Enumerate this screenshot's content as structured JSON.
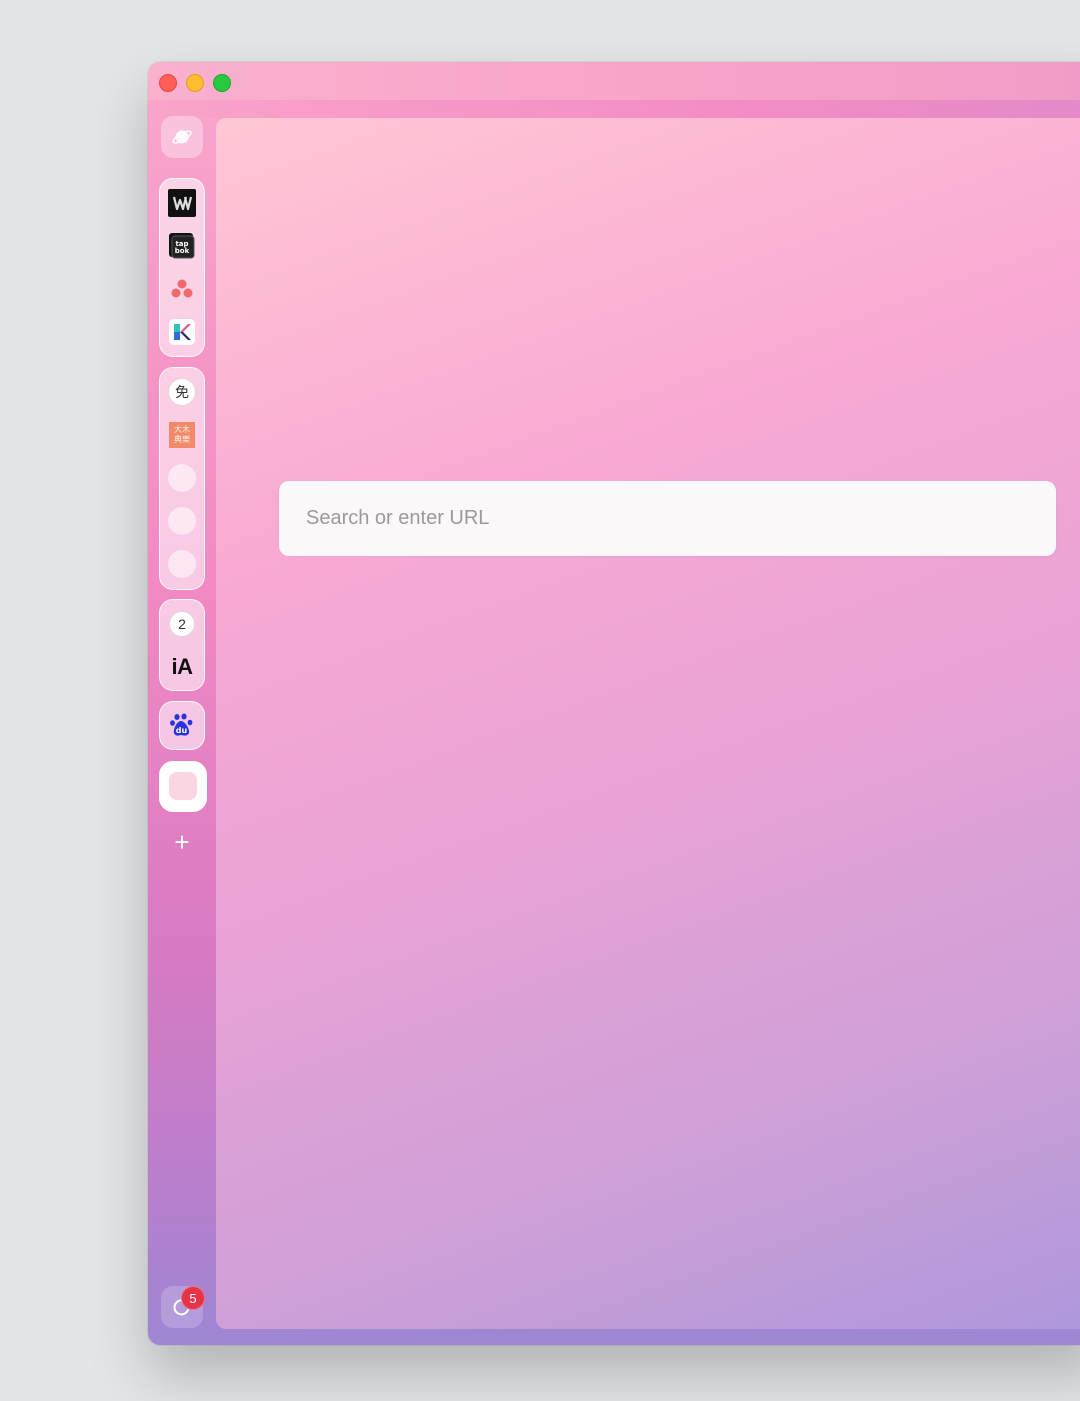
{
  "window": {
    "controls": [
      "close",
      "minimize",
      "zoom"
    ]
  },
  "sidebar": {
    "top_icon": "planet-icon",
    "groups": [
      {
        "items": [
          "webflow-icon",
          "tapbots-icon",
          "asana-icon",
          "klack-icon"
        ]
      },
      {
        "items": [
          "mian-icon",
          "dictionary-icon",
          "blank",
          "blank",
          "blank"
        ]
      },
      {
        "items": [
          {
            "badge": "2"
          },
          {
            "text": "iA"
          }
        ]
      },
      {
        "items": [
          "baidu-icon"
        ]
      },
      {
        "items": [
          "active-blank-tab"
        ]
      }
    ],
    "add_label": "+",
    "bottom": {
      "icon": "refresh-icon",
      "badge_count": "5"
    },
    "mian_glyph": "免",
    "dict_glyph": "大木典樂"
  },
  "main": {
    "search": {
      "placeholder": "Search or enter URL",
      "value": ""
    }
  },
  "colors": {
    "close": "#ff5f57",
    "minimize": "#febc2e",
    "zoom": "#28c840",
    "badge": "#e5334a"
  }
}
